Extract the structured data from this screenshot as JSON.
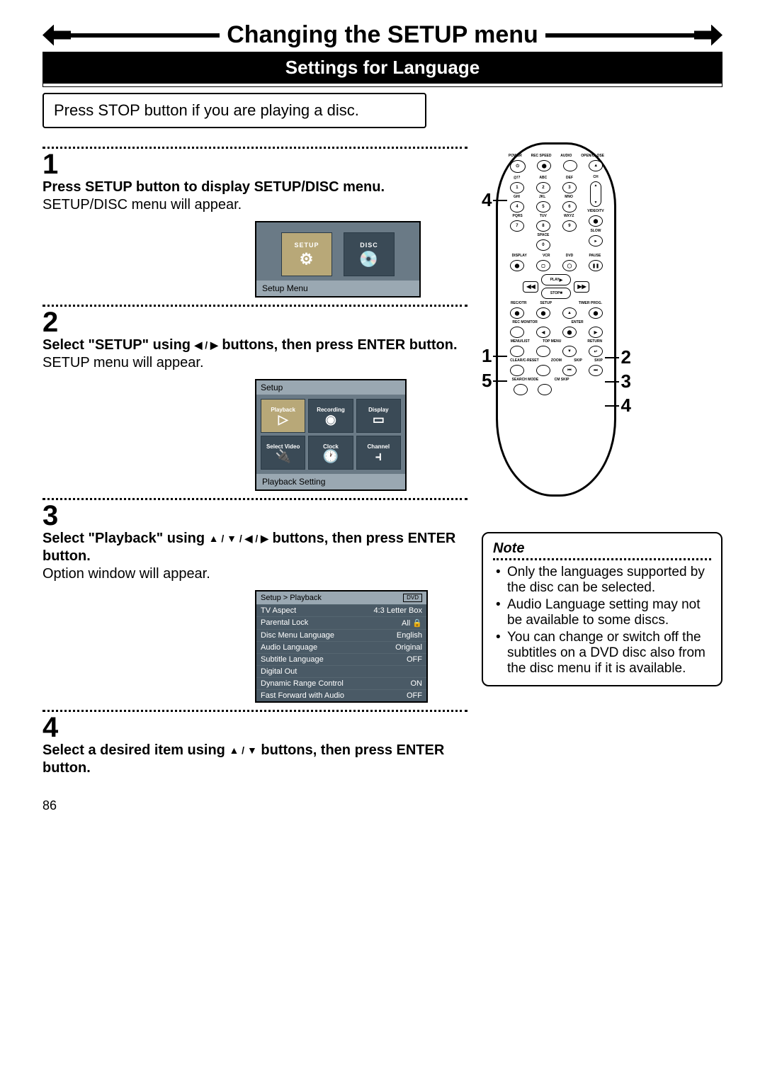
{
  "title": "Changing the SETUP menu",
  "subtitle": "Settings for Language",
  "intro": "Press STOP button if you are playing a disc.",
  "steps": {
    "s1": {
      "num": "1",
      "head": "Press SETUP button to display SETUP/DISC menu.",
      "sub": "SETUP/DISC menu will appear."
    },
    "s2": {
      "num": "2",
      "head_a": "Select \"SETUP\" using ",
      "head_b": " buttons, then press ENTER button.",
      "arrows": "◀ / ▶",
      "sub": "SETUP menu will appear."
    },
    "s3": {
      "num": "3",
      "head_a": "Select \"Playback\" using ",
      "head_b": " buttons, then press ENTER button.",
      "arrows": "▲ / ▼ / ◀ / ▶",
      "sub": "Option window will appear."
    },
    "s4": {
      "num": "4",
      "head_a": "Select a desired item using ",
      "head_b": " buttons, then press ENTER button.",
      "arrows": "▲ / ▼"
    }
  },
  "screen1": {
    "tiles": {
      "a": "SETUP",
      "b": "DISC"
    },
    "caption": "Setup Menu"
  },
  "screen2": {
    "title": "Setup",
    "cells": [
      "Playback",
      "Recording",
      "Display",
      "Select Video",
      "Clock",
      "Channel"
    ],
    "caption": "Playback Setting"
  },
  "screen3": {
    "breadcrumb": "Setup > Playback",
    "badge": "DVD",
    "rows": [
      {
        "k": "TV Aspect",
        "v": "4:3 Letter Box"
      },
      {
        "k": "Parental Lock",
        "v": "All   🔒"
      },
      {
        "k": "Disc Menu Language",
        "v": "English"
      },
      {
        "k": "Audio Language",
        "v": "Original"
      },
      {
        "k": "Subtitle Language",
        "v": "OFF"
      },
      {
        "k": "Digital Out",
        "v": ""
      },
      {
        "k": "Dynamic Range Control",
        "v": "ON"
      },
      {
        "k": "Fast Forward with Audio",
        "v": "OFF"
      }
    ]
  },
  "remote": {
    "top_labels": [
      "POWER",
      "REC SPEED",
      "AUDIO",
      "OPEN/CLOSE"
    ],
    "num_labels_r1": [
      "@!?",
      "ABC",
      "DEF"
    ],
    "num_r1": [
      "1",
      "2",
      "3"
    ],
    "num_labels_r2": [
      "GHI",
      "JKL",
      "MNO"
    ],
    "num_r2": [
      "4",
      "5",
      "6"
    ],
    "num_labels_r3": [
      "PQRS",
      "TUV",
      "WXYZ"
    ],
    "num_r3": [
      "7",
      "8",
      "9"
    ],
    "num_labels_r4": [
      "",
      "SPACE",
      ""
    ],
    "num_r4": [
      "",
      "0",
      ""
    ],
    "ch_label": "CH",
    "videotv_label": "VIDEO/TV",
    "slow_label": "SLOW",
    "row5_labels": [
      "DISPLAY",
      "VCR",
      "DVD",
      "PAUSE"
    ],
    "play": "PLAY",
    "stop": "STOP",
    "row7_labels": [
      "REC/OTR",
      "SETUP",
      "",
      "TIMER PROG."
    ],
    "row8_labels": [
      "REC MONITOR",
      "",
      "ENTER",
      ""
    ],
    "row9_labels": [
      "MENU/LIST",
      "TOP MENU",
      "",
      "RETURN"
    ],
    "row10_labels": [
      "CLEAR/C-RESET",
      "ZOOM",
      "SKIP",
      "SKIP"
    ],
    "row11_labels": [
      "SEARCH MODE",
      "CM SKIP",
      "",
      ""
    ]
  },
  "remote_callouts": {
    "left": [
      "4",
      "1",
      "5"
    ],
    "right": [
      "2",
      "3",
      "4"
    ]
  },
  "note": {
    "title": "Note",
    "items": [
      "Only the languages supported by the disc can be selected.",
      "Audio Language setting may not be available to some discs.",
      "You can change or switch off the subtitles on a DVD disc also from the disc menu if it is available."
    ]
  },
  "page_number": "86"
}
